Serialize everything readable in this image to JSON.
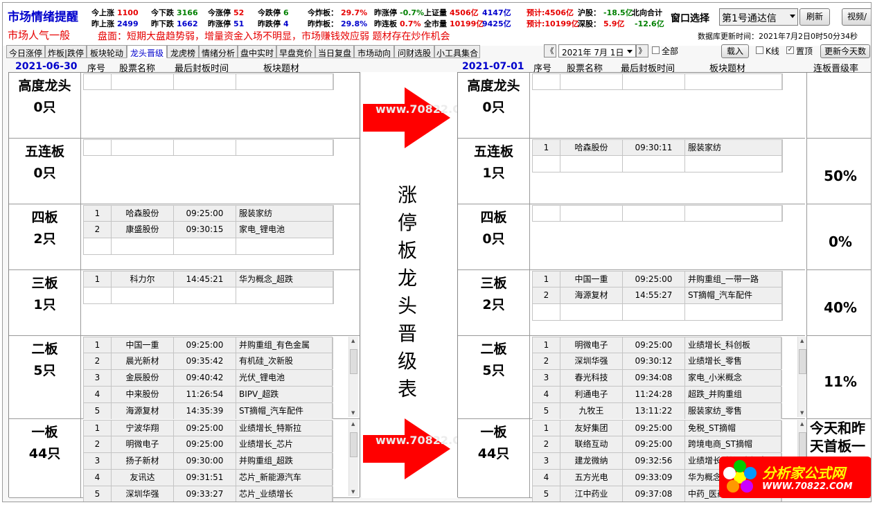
{
  "header": {
    "title": "市场情绪提醒",
    "mood": "市场人气一般",
    "board_comment": "盘面：短期大盘趋势弱，增量资金入场不明显，市场赚钱效应弱    题材存在炒作机会",
    "stats_row1": [
      {
        "label": "今上涨",
        "value": "1100",
        "color": "red"
      },
      {
        "label": "今下跌",
        "value": "3166",
        "color": "green"
      },
      {
        "label": "今涨停",
        "value": "52",
        "color": "red"
      },
      {
        "label": "今跌停",
        "value": "6",
        "color": "green"
      },
      {
        "label": "今炸板：",
        "value": "29.7%",
        "color": "red"
      },
      {
        "label": "昨涨停",
        "value": "-0.7%",
        "color": "green"
      },
      {
        "label": "上证量",
        "value": "4506亿",
        "color": "red"
      },
      {
        "label": "",
        "value": "4147亿",
        "color": "blue"
      },
      {
        "label": "",
        "value": "预计:4506亿",
        "color": "red"
      },
      {
        "label": "沪股：",
        "value": "-18.5亿",
        "color": "green"
      },
      {
        "label": "北向合计",
        "value": "",
        "color": "black"
      }
    ],
    "stats_row2": [
      {
        "label": "昨上涨",
        "value": "2499",
        "color": "blue"
      },
      {
        "label": "昨下跌",
        "value": "1662",
        "color": "blue"
      },
      {
        "label": "昨涨停",
        "value": "51",
        "color": "blue"
      },
      {
        "label": "昨跌停",
        "value": "4",
        "color": "blue"
      },
      {
        "label": "昨炸板：",
        "value": "29.8%",
        "color": "blue"
      },
      {
        "label": "昨连板",
        "value": "0.7%",
        "color": "red"
      },
      {
        "label": "全市量",
        "value": "10199亿",
        "color": "red"
      },
      {
        "label": "",
        "value": "9425亿",
        "color": "blue"
      },
      {
        "label": "",
        "value": "预计:10199亿",
        "color": "red"
      },
      {
        "label": "深股：",
        "value": "5.9亿",
        "color": "red"
      },
      {
        "label": "",
        "value": "-12.6亿",
        "color": "green"
      }
    ],
    "window_select_label": "窗口选择",
    "window_select_value": "第1号通达信",
    "refresh_label": "刷新",
    "video_label": "视频/",
    "db_update_time": "数据库更新时间：2021年7月2日0时50分34秒"
  },
  "tabs": [
    "今日涨停",
    "炸板|跌停",
    "板块轮动",
    "龙头晋级",
    "龙虎榜",
    "情绪分析",
    "盘中实时",
    "早盘竞价",
    "当日复盘",
    "市场动向",
    "问财选股",
    "小工具集合"
  ],
  "active_tab": "龙头晋级",
  "date_nav": {
    "prev": "《",
    "date": "2021年 7月 1日",
    "next": "》",
    "all_label": "全部",
    "load_label": "载入",
    "kline_label": "K线",
    "pin_label": "置顶",
    "update_today_label": "更新今天数"
  },
  "columns": [
    "序号",
    "股票名称",
    "最后封板时间",
    "板块题材"
  ],
  "left_date": "2021-06-30",
  "right_date": "2021-07-01",
  "rate_header": "连板晋级率",
  "center_text": [
    "涨",
    "停",
    "板",
    "龙",
    "头",
    "晋",
    "级",
    "表"
  ],
  "watermark": "www.70822.Com",
  "left_tiers": [
    {
      "name": "高度龙头",
      "count": "0只",
      "rows": []
    },
    {
      "name": "五连板",
      "count": "0只",
      "rows": []
    },
    {
      "name": "四板",
      "count": "2只",
      "rows": [
        [
          "1",
          "哈森股份",
          "09:25:00",
          "服装家纺"
        ],
        [
          "2",
          "康盛股份",
          "09:30:15",
          "家电_锂电池"
        ]
      ]
    },
    {
      "name": "三板",
      "count": "1只",
      "rows": [
        [
          "1",
          "科力尔",
          "14:45:21",
          "华为概念_超跌"
        ]
      ]
    },
    {
      "name": "二板",
      "count": "5只",
      "rows": [
        [
          "1",
          "中国一重",
          "09:25:00",
          "并购重组_有色金属"
        ],
        [
          "2",
          "晨光新材",
          "09:35:42",
          "有机硅_次新股"
        ],
        [
          "3",
          "金辰股份",
          "09:40:42",
          "光伏_锂电池"
        ],
        [
          "4",
          "中来股份",
          "11:26:54",
          "BIPV_超跌"
        ],
        [
          "5",
          "海源复材",
          "14:35:39",
          "ST摘帽_汽车配件"
        ]
      ]
    },
    {
      "name": "一板",
      "count": "44只",
      "rows": [
        [
          "1",
          "宁波华翔",
          "09:25:00",
          "业绩增长_特斯拉"
        ],
        [
          "2",
          "明微电子",
          "09:25:00",
          "业绩增长_芯片"
        ],
        [
          "3",
          "扬子新材",
          "09:30:00",
          "并购重组_超跌"
        ],
        [
          "4",
          "友讯达",
          "09:31:51",
          "芯片_新能源汽车"
        ],
        [
          "5",
          "深圳华强",
          "09:33:27",
          "芯片_业绩增长"
        ]
      ]
    }
  ],
  "right_tiers": [
    {
      "name": "高度龙头",
      "count": "0只",
      "rate": "",
      "rows": []
    },
    {
      "name": "五连板",
      "count": "1只",
      "rate": "50%",
      "rows": [
        [
          "1",
          "哈森股份",
          "09:30:11",
          "服装家纺"
        ]
      ]
    },
    {
      "name": "四板",
      "count": "0只",
      "rate": "0%",
      "rows": []
    },
    {
      "name": "三板",
      "count": "2只",
      "rate": "40%",
      "rows": [
        [
          "1",
          "中国一重",
          "09:25:00",
          "并购重组_一带一路"
        ],
        [
          "2",
          "海源复材",
          "14:55:27",
          "ST摘帽_汽车配件"
        ]
      ]
    },
    {
      "name": "二板",
      "count": "5只",
      "rate": "11%",
      "rows": [
        [
          "1",
          "明微电子",
          "09:25:00",
          "业绩增长_科创板"
        ],
        [
          "2",
          "深圳华强",
          "09:30:12",
          "业绩增长_零售"
        ],
        [
          "3",
          "春光科技",
          "09:34:08",
          "家电_小米概念"
        ],
        [
          "4",
          "利通电子",
          "11:24:28",
          "超跌_并购重组"
        ],
        [
          "5",
          "九牧王",
          "13:11:22",
          "服装家纺_零售"
        ]
      ]
    },
    {
      "name": "一板",
      "count": "44只",
      "rate": "今天和昨天首板一",
      "rows": [
        [
          "1",
          "友好集团",
          "09:25:00",
          "免税_ST摘帽"
        ],
        [
          "2",
          "联络互动",
          "09:25:00",
          "跨境电商_ST摘帽"
        ],
        [
          "3",
          "建龙微纳",
          "09:32:56",
          "业绩增长_核污水概念"
        ],
        [
          "4",
          "五方光电",
          "09:33:09",
          "华为概念_超"
        ],
        [
          "5",
          "江中药业",
          "09:37:08",
          "中药_医药"
        ]
      ]
    }
  ],
  "logo": {
    "title": "分析家公式网",
    "url": "WWW.70822.COM"
  },
  "colors": {
    "red": "#e60000",
    "green": "#008000",
    "blue": "#0000cc",
    "arrow": "#ff0000"
  }
}
